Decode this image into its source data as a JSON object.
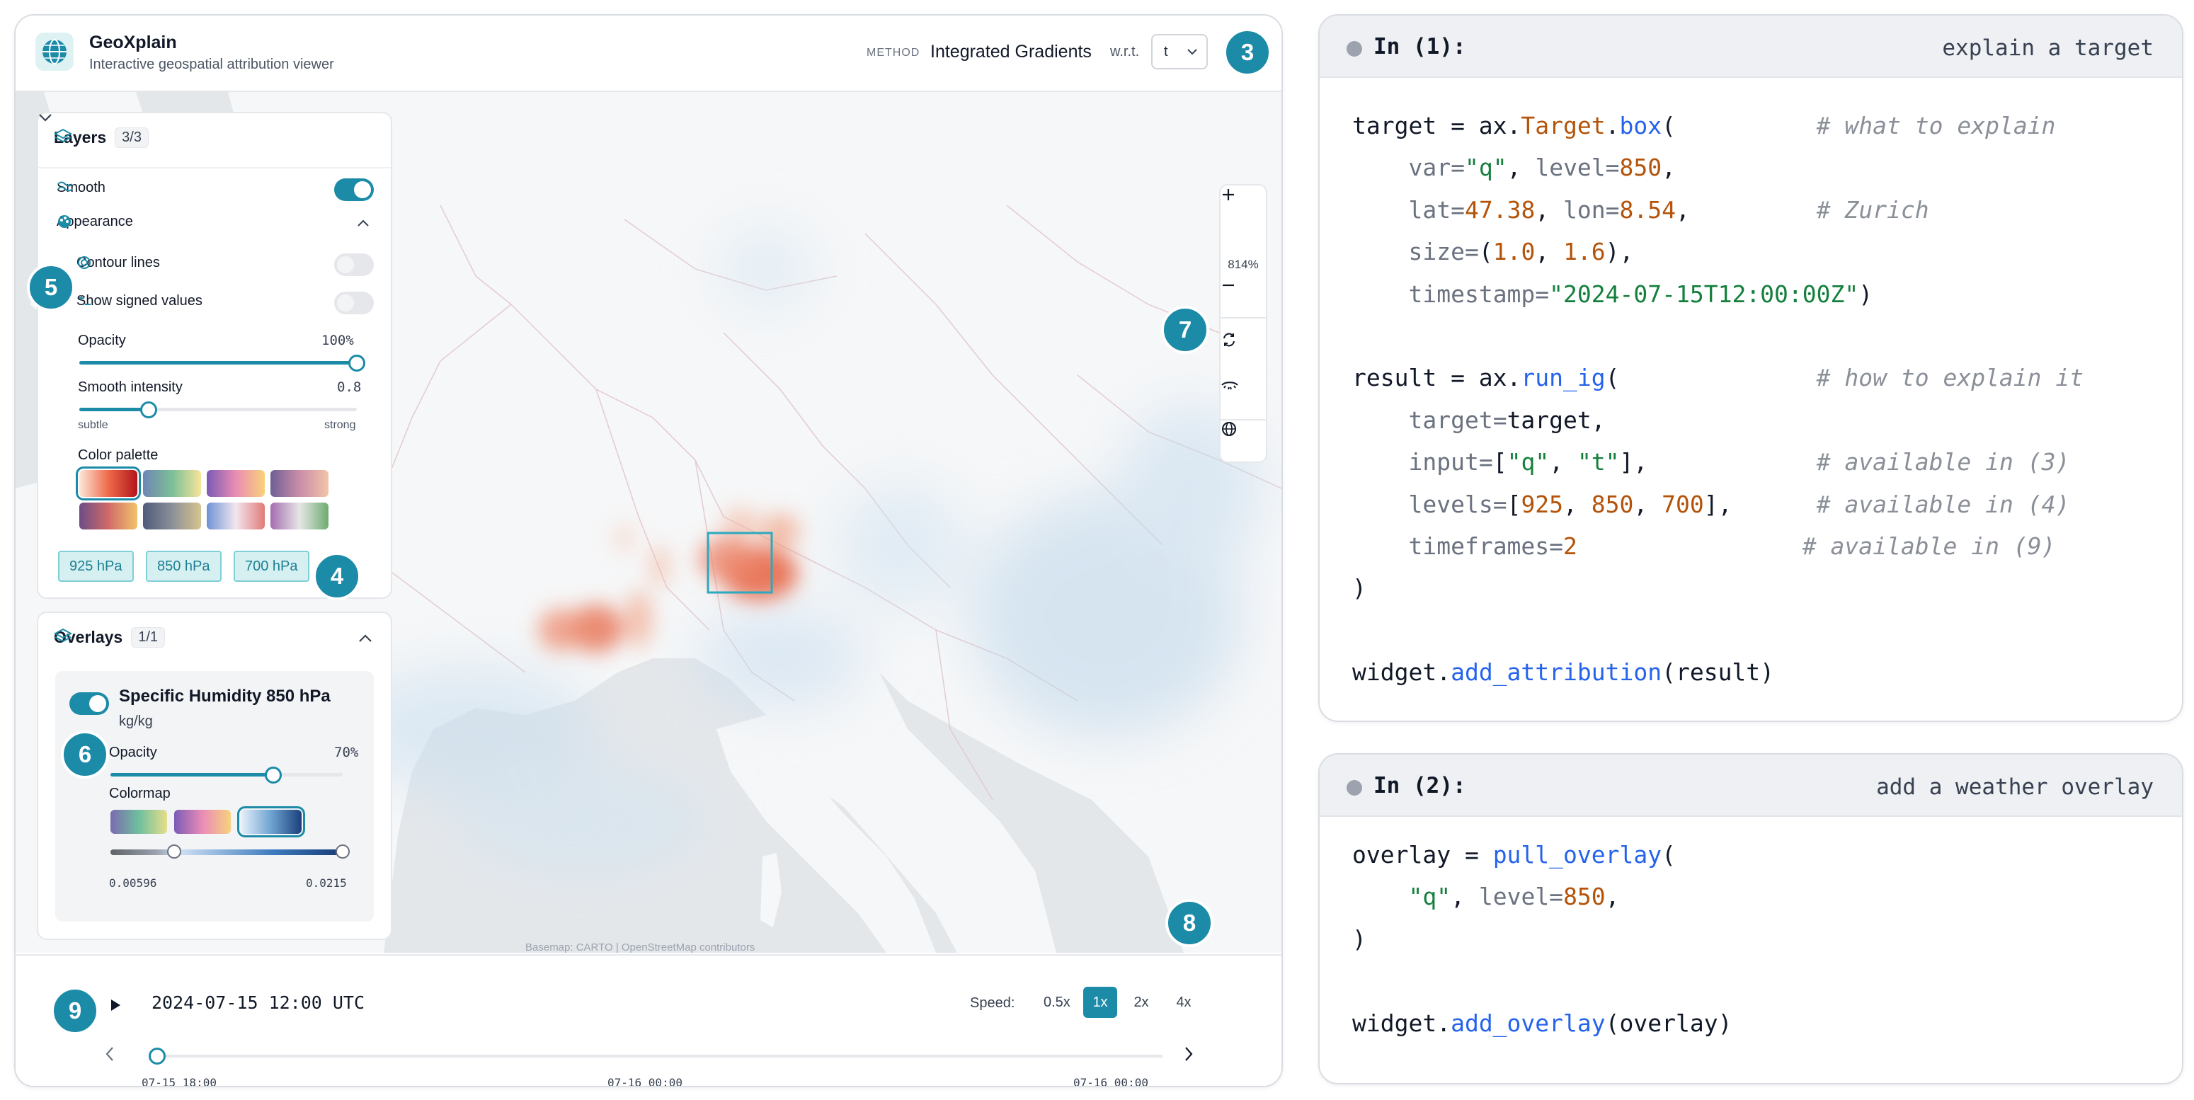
{
  "app": {
    "title": "GeoXplain",
    "subtitle": "Interactive geospatial attribution viewer",
    "method_label": "METHOD",
    "method_value": "Integrated Gradients",
    "wrt_label": "w.r.t.",
    "wrt_value": "t",
    "icon": "globe-icon"
  },
  "badges": [
    "3",
    "4",
    "5",
    "6",
    "7",
    "8",
    "9"
  ],
  "layers": {
    "title": "Layers",
    "count": "3/3",
    "smooth_label": "Smooth",
    "smooth_on": true,
    "appearance_label": "Appearance",
    "contour_label": "Contour lines",
    "contour_on": false,
    "signed_label": "Show signed values",
    "signed_on": false,
    "opacity_label": "Opacity",
    "opacity_value": "100%",
    "opacity_fraction": 1.0,
    "smooth_intensity_label": "Smooth intensity",
    "smooth_intensity_value": "0.8",
    "smooth_intensity_fraction": 0.25,
    "subtle_label": "subtle",
    "strong_label": "strong",
    "palette_label": "Color palette",
    "levels": [
      "925 hPa",
      "850 hPa",
      "700 hPa"
    ]
  },
  "overlays": {
    "title": "Overlays",
    "count": "1/1",
    "name": "Specific Humidity 850 hPa",
    "unit": "kg/kg",
    "enabled": true,
    "opacity_label": "Opacity",
    "opacity_value": "70%",
    "opacity_fraction": 0.7,
    "colormap_label": "Colormap",
    "range_min": "0.00596",
    "range_max": "0.0215"
  },
  "map": {
    "zoom": "814%",
    "attribution": "Basemap: CARTO | OpenStreetMap contributors"
  },
  "timeline": {
    "current_time": "2024-07-15 12:00 UTC",
    "speed_label": "Speed:",
    "speeds": [
      "0.5x",
      "1x",
      "2x",
      "4x"
    ],
    "active_speed": "1x",
    "ticks": [
      "07-15 18:00",
      "07-16 00:00",
      "07-16 00:00"
    ]
  },
  "cells": [
    {
      "label": "In (1):",
      "caption": "explain a target"
    },
    {
      "label": "In (2):",
      "caption": "add a weather overlay"
    }
  ]
}
